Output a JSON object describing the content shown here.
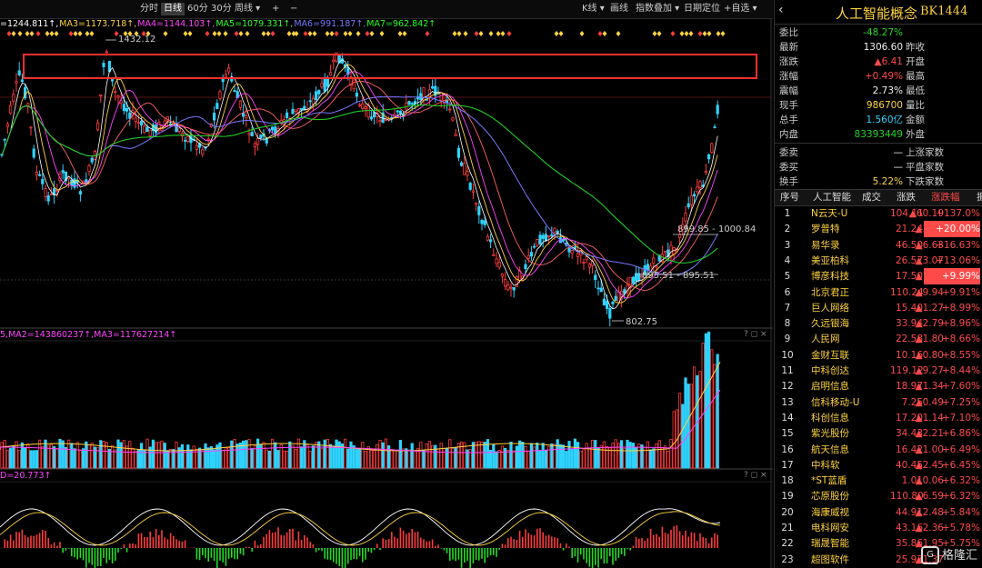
{
  "toolbar": {
    "periods": [
      "分时",
      "日线",
      "60分",
      "30分",
      "周线"
    ],
    "active_period": "日线",
    "zoom_in": "+",
    "zoom_out": "−",
    "right_buttons": [
      "K线",
      "画线",
      "指数叠加",
      "日期定位",
      "自选"
    ]
  },
  "main_chart": {
    "ma_labels": [
      {
        "text": "=1244.811↑,",
        "color": "#ffffff"
      },
      {
        "text": "MA3=1173.718↑,",
        "color": "#ffd23f"
      },
      {
        "text": "MA4=1144.103↑,",
        "color": "#ff44ff"
      },
      {
        "text": "MA5=1079.331↑,",
        "color": "#33ff33"
      },
      {
        "text": "MA6=991.187↑,",
        "color": "#7777ff"
      },
      {
        "text": "MA7=962.842↑",
        "color": "#22ff22"
      }
    ],
    "annotations": {
      "high": "1432.12",
      "low": "802.75",
      "mid1": "899.85 - 1000.84",
      "mid2": "895.51 - 895.51"
    },
    "highlight_box_color": "#ff3030"
  },
  "volume_chart": {
    "ma_label": "5,MA2=143860237↑,MA3=117627214↑"
  },
  "indicator_chart": {
    "label": "D=20.773↑"
  },
  "panel_controls": "? ◻ ×",
  "quote": {
    "back_icon": "‹",
    "name": "人工智能概念",
    "code": "BK1444",
    "rows": [
      {
        "label": "委比",
        "value": "-48.27%",
        "color": "green",
        "label2": "",
        "value2": ""
      },
      {
        "label": "最新",
        "value": "1306.60",
        "color": "white",
        "label2": "昨收",
        "value2": ""
      },
      {
        "label": "涨跌",
        "value": "▲6.41",
        "color": "red",
        "label2": "开盘",
        "value2": ""
      },
      {
        "label": "涨幅",
        "value": "+0.49%",
        "color": "red",
        "label2": "最高",
        "value2": ""
      },
      {
        "label": "震幅",
        "value": "2.73%",
        "color": "white",
        "label2": "最低",
        "value2": ""
      },
      {
        "label": "现手",
        "value": "986700",
        "color": "yellow",
        "label2": "量比",
        "value2": ""
      },
      {
        "label": "总手",
        "value": "1.560亿",
        "color": "cyan",
        "label2": "金额",
        "value2": ""
      },
      {
        "label": "内盘",
        "value": "83393449",
        "color": "green",
        "label2": "外盘",
        "value2": ""
      },
      {
        "label": "委卖",
        "value": "—",
        "color": "white",
        "label2": "上涨家数",
        "value2": ""
      },
      {
        "label": "委买",
        "value": "—",
        "color": "white",
        "label2": "平盘家数",
        "value2": ""
      },
      {
        "label": "换手",
        "value": "5.22%",
        "color": "yellow",
        "label2": "下跌家数",
        "value2": ""
      }
    ],
    "table_headers": [
      "序号",
      "人工智能",
      "成交",
      "涨跌",
      "涨跌幅",
      "振"
    ],
    "table": [
      {
        "idx": "1",
        "name": "N云天-U",
        "price": "104.11",
        "chg": "▲60.19",
        "pct": "+137.0%",
        "hl": false
      },
      {
        "idx": "2",
        "name": "罗普特",
        "price": "21.24",
        "chg": "▲3.54",
        "pct": "+20.00%",
        "hl": true
      },
      {
        "idx": "3",
        "name": "易华录",
        "price": "46.50",
        "chg": "▲6.63",
        "pct": "+16.63%",
        "hl": false
      },
      {
        "idx": "4",
        "name": "美亚柏科",
        "price": "26.57",
        "chg": "▲3.07",
        "pct": "+13.06%",
        "hl": false
      },
      {
        "idx": "5",
        "name": "博彦科技",
        "price": "17.50",
        "chg": "▲1.59",
        "pct": "+9.99%",
        "hl": true
      },
      {
        "idx": "6",
        "name": "北京君正",
        "price": "110.24",
        "chg": "▲9.94",
        "pct": "+9.91%",
        "hl": false
      },
      {
        "idx": "7",
        "name": "巨人网络",
        "price": "15.40",
        "chg": "▲1.27",
        "pct": "+8.99%",
        "hl": false
      },
      {
        "idx": "8",
        "name": "久远银海",
        "price": "33.94",
        "chg": "▲2.79",
        "pct": "+8.96%",
        "hl": false
      },
      {
        "idx": "9",
        "name": "人民网",
        "price": "22.58",
        "chg": "▲1.80",
        "pct": "+8.66%",
        "hl": false
      },
      {
        "idx": "10",
        "name": "金财互联",
        "price": "10.16",
        "chg": "▲0.80",
        "pct": "+8.55%",
        "hl": false
      },
      {
        "idx": "11",
        "name": "中科创达",
        "price": "119.12",
        "chg": "▲9.27",
        "pct": "+8.44%",
        "hl": false
      },
      {
        "idx": "12",
        "name": "启明信息",
        "price": "18.97",
        "chg": "▲1.34",
        "pct": "+7.60%",
        "hl": false
      },
      {
        "idx": "13",
        "name": "信科移动-U",
        "price": "7.25",
        "chg": "▲0.49",
        "pct": "+7.25%",
        "hl": false
      },
      {
        "idx": "14",
        "name": "科创信息",
        "price": "17.20",
        "chg": "▲1.14",
        "pct": "+7.10%",
        "hl": false
      },
      {
        "idx": "15",
        "name": "紫光股份",
        "price": "34.43",
        "chg": "▲2.21",
        "pct": "+6.86%",
        "hl": false
      },
      {
        "idx": "16",
        "name": "航天信息",
        "price": "16.42",
        "chg": "▲1.00",
        "pct": "+6.49%",
        "hl": false
      },
      {
        "idx": "17",
        "name": "中科软",
        "price": "40.45",
        "chg": "▲2.45",
        "pct": "+6.45%",
        "hl": false
      },
      {
        "idx": "18",
        "name": "*ST蓝盾",
        "price": "1.01",
        "chg": "▲0.06",
        "pct": "+6.32%",
        "hl": false
      },
      {
        "idx": "19",
        "name": "芯原股份",
        "price": "110.80",
        "chg": "▲6.59",
        "pct": "+6.32%",
        "hl": false
      },
      {
        "idx": "20",
        "name": "海康威视",
        "price": "44.91",
        "chg": "▲2.48",
        "pct": "+5.84%",
        "hl": false
      },
      {
        "idx": "21",
        "name": "电科网安",
        "price": "43.16",
        "chg": "▲2.36",
        "pct": "+5.78%",
        "hl": false
      },
      {
        "idx": "22",
        "name": "瑞晟智能",
        "price": "35.86",
        "chg": "▲1.95",
        "pct": "+5.75%",
        "hl": false
      },
      {
        "idx": "23",
        "name": "超图软件",
        "price": "25.97",
        "chg": "▲1.37",
        "pct": "",
        "hl": false
      }
    ]
  },
  "watermark": {
    "glyph": "G",
    "text": "格隆汇"
  }
}
